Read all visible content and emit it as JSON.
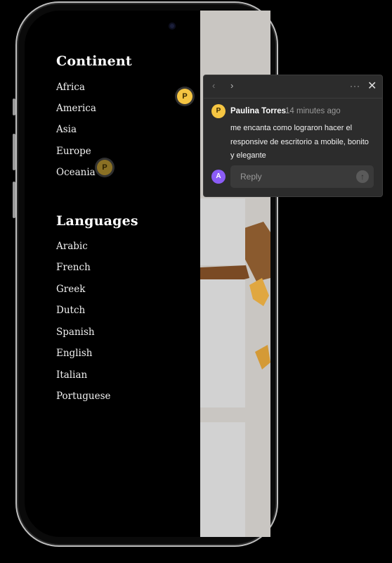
{
  "menu": {
    "continent_heading": "Continent",
    "continents": [
      "Africa",
      "America",
      "Asia",
      "Europe",
      "Oceania"
    ],
    "languages_heading": "Languages",
    "languages": [
      "Arabic",
      "French",
      "Greek",
      "Dutch",
      "Spanish",
      "English",
      "Italian",
      "Portuguese"
    ]
  },
  "pins": {
    "pin_1": "P",
    "pin_2": "P"
  },
  "comment": {
    "avatar_initial": "P",
    "author": "Paulina Torres",
    "time": "14 minutes ago",
    "body": "me encanta como lograron hacer el responsive de escritorio a mobile, bonito y elegante",
    "reply_avatar_initial": "A",
    "reply_placeholder": "Reply"
  },
  "icons": {
    "prev": "chevron-left-icon",
    "next": "chevron-right-icon",
    "more": "more-horizontal-icon",
    "close": "close-icon",
    "send": "arrow-up-icon"
  },
  "colors": {
    "pin": "#f5c542",
    "reply_avatar": "#8b5cf6",
    "panel": "#2c2c2c"
  }
}
